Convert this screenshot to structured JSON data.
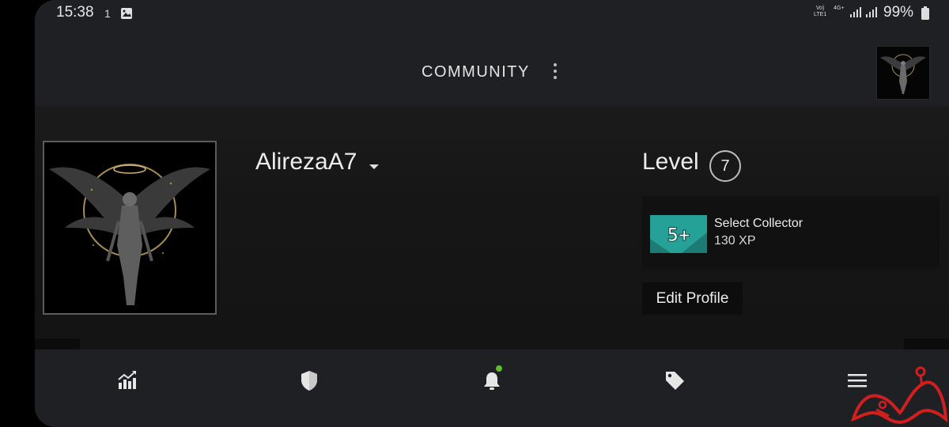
{
  "status_bar": {
    "time": "15:38",
    "notification_count": "1",
    "network_label_1": "Vo)) LTE1",
    "network_label_2": "4G+",
    "battery": "99%"
  },
  "header": {
    "title": "COMMUNITY"
  },
  "profile": {
    "username": "AlirezaA7",
    "level_label": "Level",
    "level_value": "7",
    "badge": {
      "icon_text": "5+",
      "name": "Select Collector",
      "xp": "130 XP"
    },
    "edit_button_label": "Edit Profile"
  },
  "bottom_nav": {
    "items": [
      {
        "icon": "chart-icon"
      },
      {
        "icon": "shield-icon"
      },
      {
        "icon": "bell-icon",
        "has_notification": true
      },
      {
        "icon": "tag-icon"
      },
      {
        "icon": "menu-icon"
      }
    ]
  },
  "colors": {
    "background": "#1f2024",
    "profile_bg": "#161616",
    "badge_teal": "#26a197",
    "notification_dot": "#5bbf2a",
    "watermark_red": "#d01f1f"
  }
}
